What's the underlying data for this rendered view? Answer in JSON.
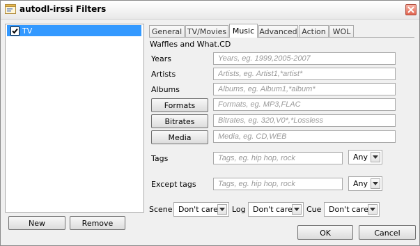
{
  "window": {
    "title": "autodl-irssi Filters",
    "app_icon": "filter-window-icon",
    "close_icon": "close-icon"
  },
  "filter_list": {
    "items": [
      {
        "label": "TV",
        "checked": true
      }
    ]
  },
  "list_buttons": {
    "new": "New",
    "remove": "Remove"
  },
  "tabs": [
    {
      "label": "General"
    },
    {
      "label": "TV/Movies"
    },
    {
      "label": "Music",
      "active": true
    },
    {
      "label": "Advanced"
    },
    {
      "label": "Action"
    },
    {
      "label": "WOL"
    }
  ],
  "music": {
    "site_label": "Waffles and What.CD",
    "years": {
      "label": "Years",
      "placeholder": "Years, eg. 1999,2005-2007"
    },
    "artists": {
      "label": "Artists",
      "placeholder": "Artists, eg. Artist1,*artist*"
    },
    "albums": {
      "label": "Albums",
      "placeholder": "Albums, eg. Album1,*album*"
    },
    "formats": {
      "button": "Formats",
      "placeholder": "Formats, eg. MP3,FLAC"
    },
    "bitrates": {
      "button": "Bitrates",
      "placeholder": "Bitrates, eg. 320,V0*,*Lossless"
    },
    "media": {
      "button": "Media",
      "placeholder": "Media, eg. CD,WEB"
    },
    "tags": {
      "label": "Tags",
      "placeholder": "Tags, eg. hip hop, rock",
      "mode": "Any"
    },
    "except_tags": {
      "label": "Except tags",
      "placeholder": "Tags, eg. hip hop, rock",
      "mode": "Any"
    },
    "scene": {
      "label": "Scene",
      "value": "Don't care"
    },
    "log": {
      "label": "Log",
      "value": "Don't care"
    },
    "cue": {
      "label": "Cue",
      "value": "Don't care"
    }
  },
  "dialog_buttons": {
    "ok": "OK",
    "cancel": "Cancel"
  },
  "colors": {
    "selection": "#3399ff",
    "window_bg": "#f0f0f0",
    "placeholder": "#9a9a9a"
  }
}
